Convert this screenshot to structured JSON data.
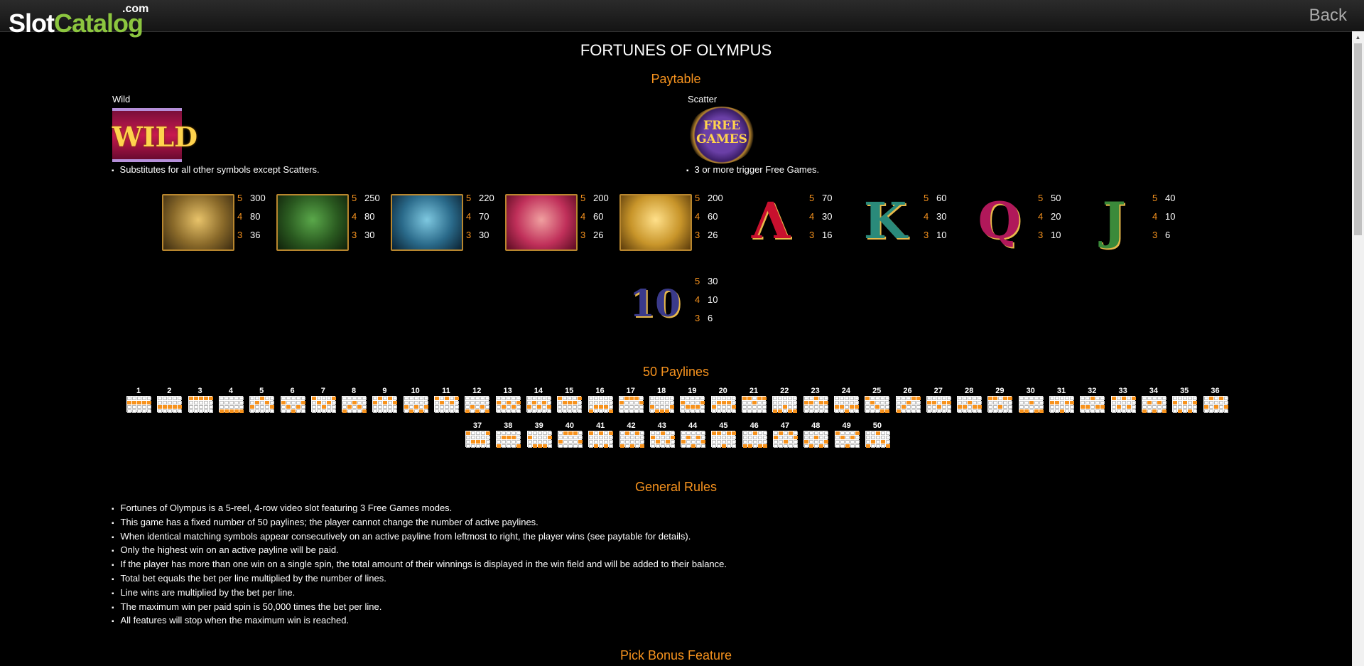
{
  "header": {
    "logo_slot": "Slot",
    "logo_catalog": "Catalog",
    "logo_com": ".com",
    "back_label": "Back"
  },
  "page": {
    "title": "FORTUNES OF OLYMPUS"
  },
  "paytable": {
    "heading": "Paytable",
    "wild": {
      "label": "Wild",
      "symbol_text": "WILD",
      "note": "Substitutes for all other symbols except Scatters."
    },
    "scatter": {
      "label": "Scatter",
      "symbol_text": "FREE GAMES",
      "note": "3 or more trigger Free Games."
    },
    "symbols": [
      {
        "name": "zeus-symbol",
        "pays": [
          [
            "5",
            "300"
          ],
          [
            "4",
            "80"
          ],
          [
            "3",
            "36"
          ]
        ]
      },
      {
        "name": "medusa-symbol",
        "pays": [
          [
            "5",
            "250"
          ],
          [
            "4",
            "80"
          ],
          [
            "3",
            "30"
          ]
        ]
      },
      {
        "name": "poseidon-symbol",
        "pays": [
          [
            "5",
            "220"
          ],
          [
            "4",
            "70"
          ],
          [
            "3",
            "30"
          ]
        ]
      },
      {
        "name": "athena-symbol",
        "pays": [
          [
            "5",
            "200"
          ],
          [
            "4",
            "60"
          ],
          [
            "3",
            "26"
          ]
        ]
      },
      {
        "name": "helmet-symbol",
        "pays": [
          [
            "5",
            "200"
          ],
          [
            "4",
            "60"
          ],
          [
            "3",
            "26"
          ]
        ]
      },
      {
        "name": "a-symbol",
        "glyph": "Λ",
        "pays": [
          [
            "5",
            "70"
          ],
          [
            "4",
            "30"
          ],
          [
            "3",
            "16"
          ]
        ]
      },
      {
        "name": "k-symbol",
        "glyph": "K",
        "pays": [
          [
            "5",
            "60"
          ],
          [
            "4",
            "30"
          ],
          [
            "3",
            "10"
          ]
        ]
      },
      {
        "name": "q-symbol",
        "glyph": "Q",
        "pays": [
          [
            "5",
            "50"
          ],
          [
            "4",
            "20"
          ],
          [
            "3",
            "10"
          ]
        ]
      },
      {
        "name": "j-symbol",
        "glyph": "J",
        "pays": [
          [
            "5",
            "40"
          ],
          [
            "4",
            "10"
          ],
          [
            "3",
            "6"
          ]
        ]
      },
      {
        "name": "ten-symbol",
        "glyph": "10",
        "pays": [
          [
            "5",
            "30"
          ],
          [
            "4",
            "10"
          ],
          [
            "3",
            "6"
          ]
        ]
      }
    ]
  },
  "paylines": {
    "heading": "50 Paylines",
    "lines": [
      [
        1,
        1,
        1,
        1,
        1
      ],
      [
        2,
        2,
        2,
        2,
        2
      ],
      [
        0,
        0,
        0,
        0,
        0
      ],
      [
        3,
        3,
        3,
        3,
        3
      ],
      [
        2,
        1,
        0,
        1,
        2
      ],
      [
        1,
        2,
        3,
        2,
        1
      ],
      [
        0,
        1,
        2,
        1,
        0
      ],
      [
        3,
        2,
        1,
        2,
        3
      ],
      [
        1,
        0,
        1,
        0,
        1
      ],
      [
        2,
        3,
        2,
        3,
        2
      ],
      [
        0,
        1,
        0,
        1,
        0
      ],
      [
        3,
        2,
        3,
        2,
        3
      ],
      [
        1,
        2,
        1,
        2,
        1
      ],
      [
        2,
        1,
        2,
        1,
        2
      ],
      [
        0,
        1,
        1,
        1,
        0
      ],
      [
        3,
        2,
        2,
        2,
        3
      ],
      [
        1,
        0,
        0,
        0,
        1
      ],
      [
        2,
        3,
        3,
        3,
        2
      ],
      [
        1,
        2,
        2,
        2,
        1
      ],
      [
        2,
        1,
        1,
        1,
        2
      ],
      [
        0,
        0,
        1,
        0,
        0
      ],
      [
        3,
        3,
        2,
        3,
        3
      ],
      [
        1,
        1,
        0,
        1,
        1
      ],
      [
        2,
        2,
        3,
        2,
        2
      ],
      [
        0,
        1,
        2,
        3,
        3
      ],
      [
        3,
        2,
        1,
        0,
        0
      ],
      [
        1,
        1,
        2,
        1,
        1
      ],
      [
        2,
        2,
        1,
        2,
        2
      ],
      [
        0,
        0,
        2,
        0,
        0
      ],
      [
        3,
        3,
        1,
        3,
        3
      ],
      [
        1,
        1,
        3,
        1,
        1
      ],
      [
        2,
        2,
        0,
        2,
        2
      ],
      [
        0,
        2,
        0,
        2,
        0
      ],
      [
        3,
        1,
        3,
        1,
        3
      ],
      [
        1,
        3,
        1,
        3,
        1
      ],
      [
        2,
        0,
        2,
        0,
        2
      ],
      [
        0,
        2,
        2,
        2,
        0
      ],
      [
        3,
        1,
        1,
        1,
        3
      ],
      [
        1,
        3,
        3,
        3,
        1
      ],
      [
        2,
        0,
        0,
        0,
        2
      ],
      [
        0,
        3,
        0,
        3,
        0
      ],
      [
        3,
        0,
        3,
        0,
        3
      ],
      [
        1,
        2,
        0,
        2,
        1
      ],
      [
        2,
        1,
        3,
        1,
        2
      ],
      [
        0,
        0,
        3,
        0,
        0
      ],
      [
        3,
        3,
        0,
        3,
        3
      ],
      [
        1,
        0,
        2,
        0,
        1
      ],
      [
        2,
        3,
        1,
        3,
        2
      ],
      [
        0,
        1,
        3,
        1,
        0
      ],
      [
        3,
        2,
        0,
        2,
        3
      ]
    ]
  },
  "rules": {
    "heading": "General Rules",
    "items": [
      "Fortunes of Olympus is a 5-reel, 4-row video slot featuring 3 Free Games modes.",
      "This game has a fixed number of 50 paylines; the player cannot change the number of active paylines.",
      "When identical matching symbols appear consecutively on an active payline from leftmost to right, the player wins (see paytable for details).",
      "Only the highest win on an active payline will be paid.",
      "If the player has more than one win on a single spin, the total amount of their winnings is displayed in the win field and will be added to their balance.",
      "Total bet equals the bet per line multiplied by the number of lines.",
      "Line wins are multiplied by the bet per line.",
      "The maximum win per paid spin is 50,000 times the bet per line.",
      "All features will stop when the maximum win is reached."
    ]
  },
  "pick_bonus": {
    "heading": "Pick Bonus Feature"
  },
  "colors": {
    "accent": "#f7931e",
    "logo_green": "#8cc63f",
    "background": "#000000"
  }
}
